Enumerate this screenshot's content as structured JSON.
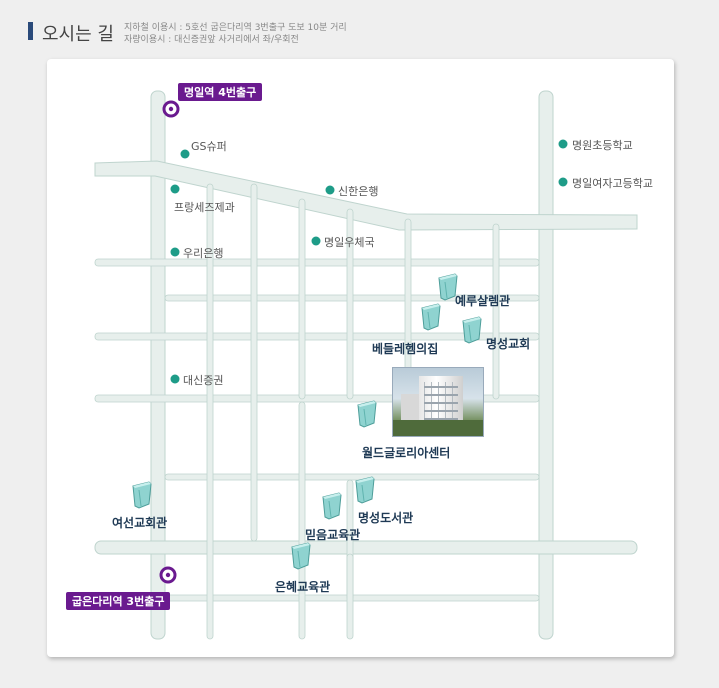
{
  "header": {
    "title": "오시는 길",
    "subway": "지하철 이용시 : 5호선 굽은다리역 3번출구 도보 10분 거리",
    "car": "자량이용시 : 대신증권앞 사거리에서 좌/우회전"
  },
  "stations": {
    "top": "명일역 4번출구",
    "bottom": "굽은다리역 3번출구"
  },
  "places": {
    "gs": "GS슈퍼",
    "shinhan": "신한은행",
    "francais": "프랑세즈제과",
    "woori": "우리은행",
    "post": "명일우체국",
    "daishin": "대신증권",
    "school1": "명원초등학교",
    "school2": "명일여자고등학교"
  },
  "buildings": {
    "erusalem": "예루살렘관",
    "bethlehem": "베들레헴의집",
    "myeongseong_church": "명성교회",
    "world_glory": "월드글로리아센터",
    "yeoseon": "여선교회관",
    "library": "명성도서관",
    "faith": "믿음교육관",
    "grace": "은혜교육관"
  },
  "colors": {
    "road": "#e7efec",
    "road_edge": "#bfd4ce",
    "marker": "#1e9c88",
    "station": "#6a1a8f",
    "building": "#8fd3d0"
  }
}
